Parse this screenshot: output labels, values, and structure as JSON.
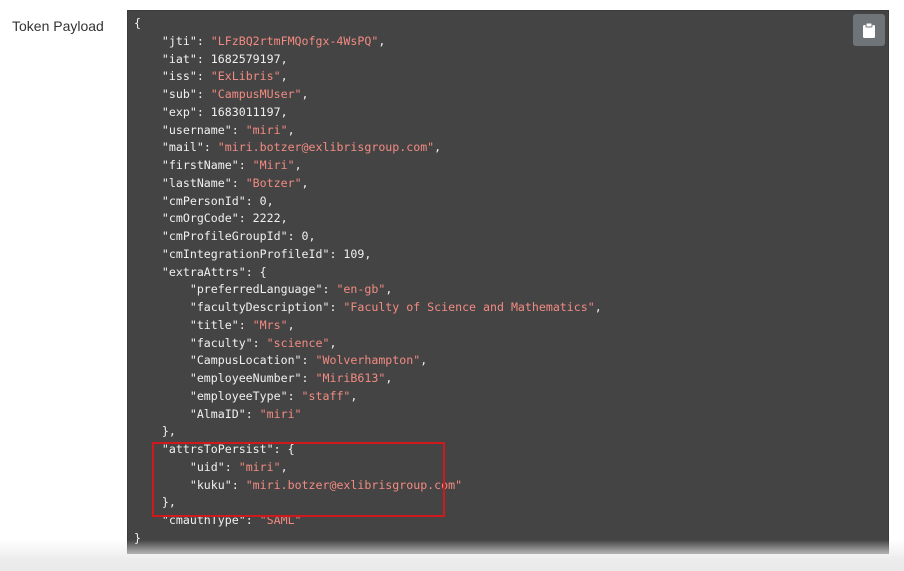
{
  "section_label": "Token Payload",
  "copy_button": {
    "icon": "clipboard-icon"
  },
  "colors": {
    "panel_background": "#444444",
    "string_value": "#f28b82",
    "highlight_border": "#d0191d"
  },
  "payload_lines": [
    "{",
    "    \"jti\": \"LFzBQ2rtmFMQofgx-4WsPQ\",",
    "    \"iat\": 1682579197,",
    "    \"iss\": \"ExLibris\",",
    "    \"sub\": \"CampusMUser\",",
    "    \"exp\": 1683011197,",
    "    \"username\": \"miri\",",
    "    \"mail\": \"miri.botzer@exlibrisgroup.com\",",
    "    \"firstName\": \"Miri\",",
    "    \"lastName\": \"Botzer\",",
    "    \"cmPersonId\": 0,",
    "    \"cmOrgCode\": 2222,",
    "    \"cmProfileGroupId\": 0,",
    "    \"cmIntegrationProfileId\": 109,",
    "    \"extraAttrs\": {",
    "        \"preferredLanguage\": \"en-gb\",",
    "        \"facultyDescription\": \"Faculty of Science and Mathematics\",",
    "        \"title\": \"Mrs\",",
    "        \"faculty\": \"science\",",
    "        \"CampusLocation\": \"Wolverhampton\",",
    "        \"employeeNumber\": \"MiriB613\",",
    "        \"employeeType\": \"staff\",",
    "        \"AlmaID\": \"miri\"",
    "    },",
    "    \"attrsToPersist\": {",
    "        \"uid\": \"miri\",",
    "        \"kuku\": \"miri.botzer@exlibrisgroup.com\"",
    "    },",
    "    \"cmauthType\": \"SAML\"",
    "}"
  ]
}
